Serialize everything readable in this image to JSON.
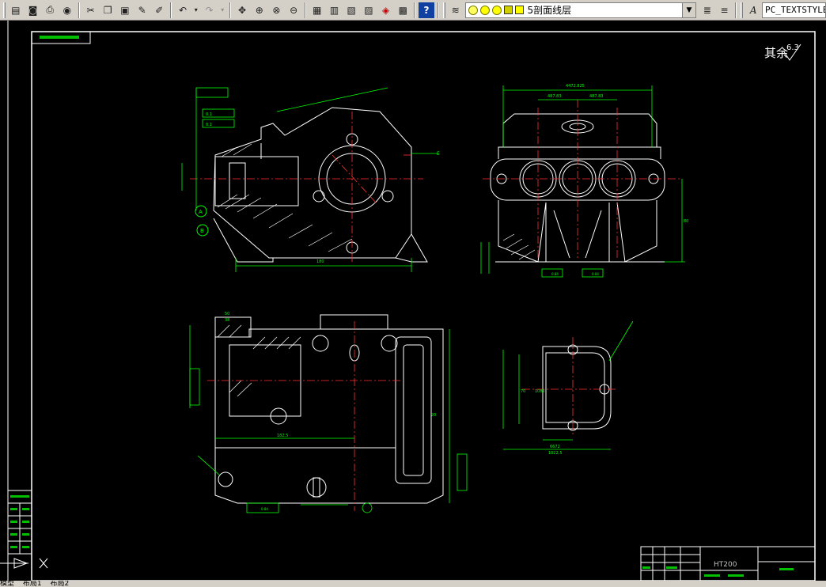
{
  "toolbar": {
    "buttons": [
      "open-icon",
      "save-icon",
      "print-icon",
      "preview-icon",
      "publish-icon",
      "cut-icon",
      "copy-icon",
      "paste-icon",
      "match-icon",
      "brush-icon",
      "undo-icon",
      "redo-icon",
      "pan-icon",
      "zoom-realtime-icon",
      "zoom-window-icon",
      "zoom-previous-icon",
      "properties-icon",
      "design-center-icon",
      "tool-palette-icon",
      "sheet-set-icon",
      "markup-icon",
      "calculator-icon",
      "help-icon"
    ],
    "layer_name": "5剖面线层",
    "text_style": "PC_TEXTSTYLE"
  },
  "drawing": {
    "surface_finish": "其余",
    "surface_value": "6.3",
    "material": "HT200",
    "tolerance_b1": "0.1",
    "tolerance_b2": "0.1",
    "dim_overall_width": "180",
    "dim_overall_length": "1022.5",
    "dim_top": "4472.825",
    "dim_tops": [
      "487.83",
      "487.83"
    ],
    "dim_height": "80",
    "dim_left_1": "50",
    "dim_left_2": "38",
    "dim_bottom_1": "182.5",
    "dim_bottom_2": "20",
    "dim_right_a": "70",
    "dim_right_b": "1082",
    "dim_right_c": "6672",
    "datum_a": "A",
    "datum_b": "B",
    "datum_e": "E",
    "roughness_labels": [
      "0.84",
      "0.84",
      "0.84"
    ]
  },
  "tabs": [
    "模型",
    "布局1",
    "布局2"
  ]
}
